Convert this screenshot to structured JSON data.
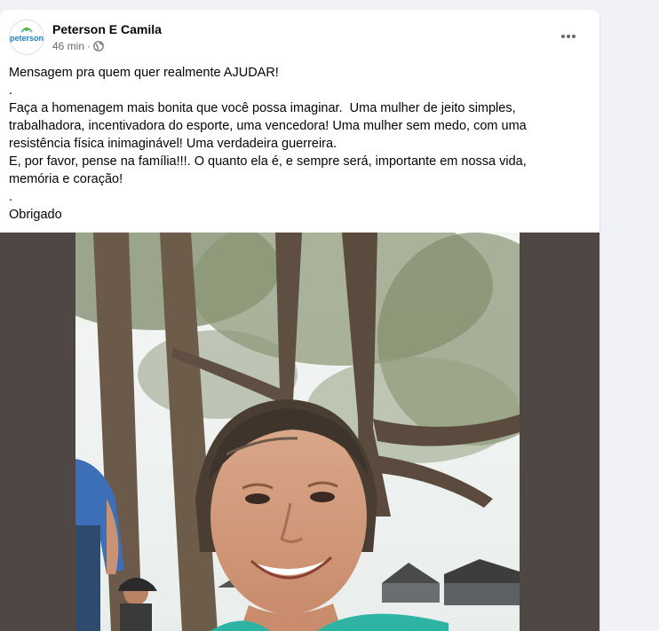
{
  "post": {
    "author": "Peterson E Camila",
    "avatar_text": "peterson",
    "time": "46 min",
    "separator": "·",
    "privacy_icon": "globe-icon",
    "more_icon": "more-options-icon",
    "lines": [
      "Mensagem pra quem quer realmente AJUDAR!",
      ".",
      "Faça a homenagem mais bonita que você possa imaginar.  Uma mulher de jeito simples,",
      "trabalhadora, incentivadora do esporte, uma vencedora! Uma mulher sem medo, com uma",
      "resistência física inimaginável! Uma verdadeira guerreira.",
      "E, por favor, pense na família!!!. O quanto ela é, e sempre será, importante em nossa vida,",
      "memória e coração!",
      ".",
      "Obrigado"
    ]
  },
  "colors": {
    "page_bg": "#f0f2f5",
    "card_bg": "#ffffff",
    "media_bg": "#4f4744",
    "text": "#050505",
    "secondary_text": "#65676b",
    "brand_blue": "#1f7fc4",
    "brand_green": "#4bb543"
  }
}
